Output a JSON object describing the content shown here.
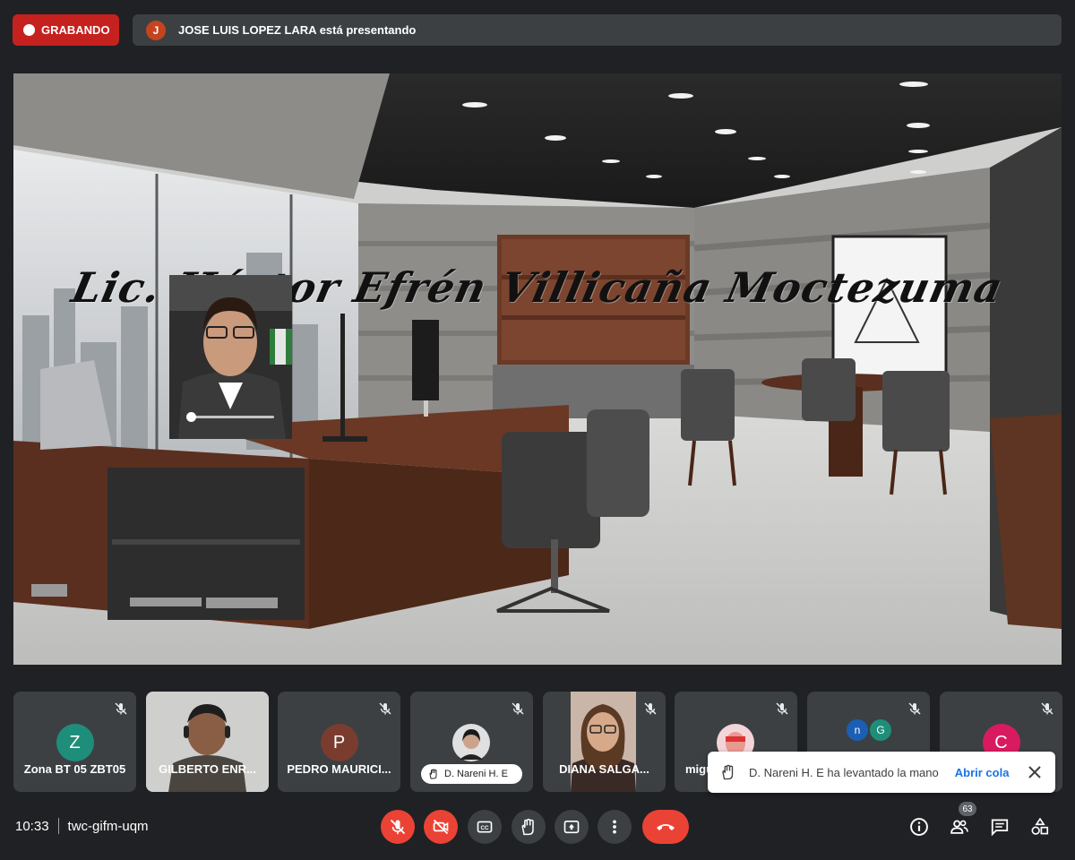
{
  "top": {
    "recording_label": "GRABANDO",
    "presenter_initial": "J",
    "presenter_text": "JOSE LUIS LOPEZ LARA está presentando"
  },
  "stage": {
    "title": "Lic. Héctor Efrén Villicaña Moctezuma"
  },
  "tiles": [
    {
      "name": "Zona BT 05 ZBT05",
      "initial": "Z",
      "avatar_color": "#1e8e7a"
    },
    {
      "name": "GILBERTO ENR..."
    },
    {
      "name": "PEDRO MAURICI...",
      "initial": "P",
      "avatar_color": "#7a3c2f"
    },
    {
      "hand_label": "D. Nareni H. E"
    },
    {
      "name": "DIANA SALGA..."
    },
    {
      "name": "migu"
    },
    {
      "initials_a": "n",
      "initials_b": "G",
      "color_a": "#1a5fb4",
      "color_b": "#1e8e7a"
    },
    {
      "initial": "C",
      "avatar_color": "#d81b60"
    }
  ],
  "toast": {
    "text": "D. Nareni H. E ha levantado la mano",
    "action": "Abrir cola"
  },
  "bottom": {
    "time": "10:33",
    "meeting_code": "twc-gifm-uqm",
    "participants_count": "63"
  },
  "colors": {
    "danger": "#ea4335",
    "panel": "#3c4043",
    "background": "#202124",
    "link": "#1a73e8"
  }
}
